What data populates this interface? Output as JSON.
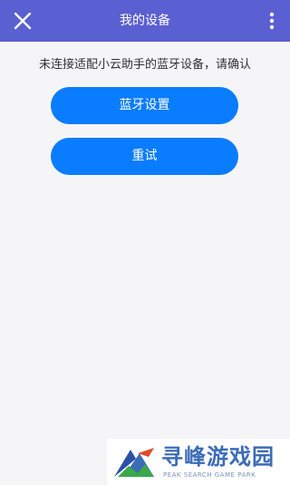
{
  "header": {
    "title": "我的设备",
    "close_icon": "close-icon",
    "more_icon": "more-vertical-icon"
  },
  "main": {
    "message": "未连接适配小云助手的蓝牙设备，请确认",
    "bluetooth_button_label": "蓝牙设置",
    "retry_button_label": "重试"
  },
  "watermark": {
    "title": "寻峰游戏园",
    "subtitle": "PEAK SEARCH GAME PARK"
  },
  "colors": {
    "header_bg": "#5a5fd1",
    "button_bg": "#0a7cff",
    "page_bg": "#f5f5f7"
  }
}
